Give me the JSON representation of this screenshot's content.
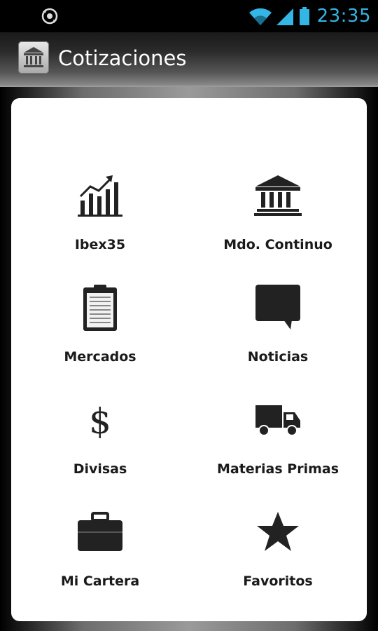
{
  "status_bar": {
    "time": "23:35",
    "icons": [
      "sync-icon",
      "wifi-icon",
      "signal-icon",
      "battery-icon"
    ]
  },
  "action_bar": {
    "title": "Cotizaciones",
    "icon": "bank-icon"
  },
  "menu": {
    "items": [
      {
        "label": "Ibex35",
        "icon": "chart-up-icon"
      },
      {
        "label": "Mdo. Continuo",
        "icon": "bank-icon"
      },
      {
        "label": "Mercados",
        "icon": "clipboard-icon"
      },
      {
        "label": "Noticias",
        "icon": "speech-bubble-icon"
      },
      {
        "label": "Divisas",
        "icon": "dollar-icon"
      },
      {
        "label": "Materias Primas",
        "icon": "truck-icon"
      },
      {
        "label": "Mi Cartera",
        "icon": "briefcase-icon"
      },
      {
        "label": "Favoritos",
        "icon": "star-icon"
      }
    ]
  },
  "colors": {
    "accent": "#33b5e5",
    "panel": "#ffffff",
    "text": "#1a1a1a"
  }
}
